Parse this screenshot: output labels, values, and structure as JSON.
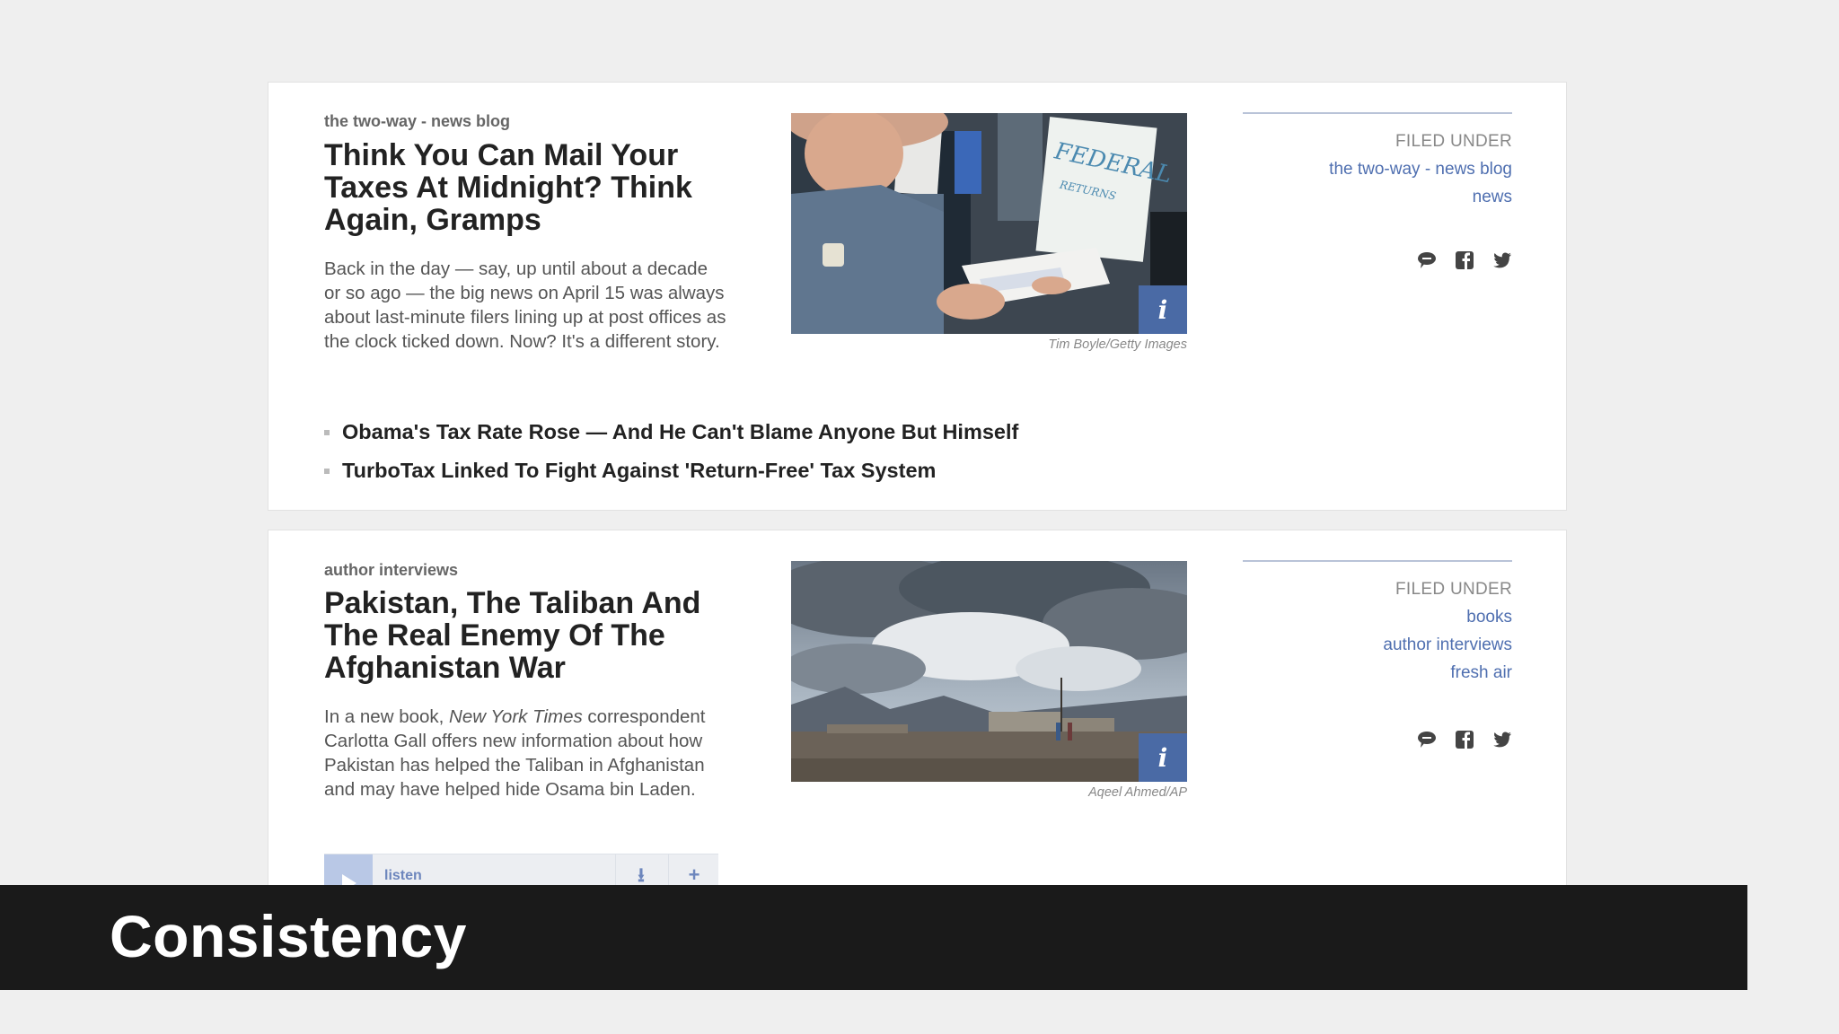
{
  "stories": [
    {
      "slug": "the two-way - news blog",
      "headline": "Think You Can Mail Your Taxes At Midnight? Think Again, Gramps",
      "teaser": "Back in the day — say, up until about a decade or so ago — the big news on April 15 was always about last-minute filers lining up at post offices as the clock ticked down. Now? It's a different story.",
      "image_credit": "Tim Boyle/Getty Images",
      "image_sign_text": "FEDERAL",
      "image_sign_subtext": "RETURNS",
      "related": [
        "Obama's Tax Rate Rose — And He Can't Blame Anyone But Himself",
        "TurboTax Linked To Fight Against 'Return-Free' Tax System"
      ],
      "filed_under_label": "FILED UNDER",
      "filed_under": [
        "the two-way - news blog",
        "news"
      ]
    },
    {
      "slug": "author interviews",
      "headline": "Pakistan, The Taliban And The Real Enemy Of The Afghanistan War",
      "teaser_parts": {
        "before": "In a new book, ",
        "italic": "New York Times",
        "after": " correspondent Carlotta Gall offers new information about how Pakistan has helped the Taliban in Afghanistan and may have helped hide Osama bin Laden."
      },
      "image_credit": "Aqeel Ahmed/AP",
      "filed_under_label": "FILED UNDER",
      "filed_under": [
        "books",
        "author interviews",
        "fresh air"
      ],
      "audio": {
        "listen_label": "listen",
        "download_glyph": "⭳",
        "add_glyph": "+"
      }
    }
  ],
  "info_glyph": "i",
  "banner": {
    "title": "Consistency"
  },
  "colors": {
    "background": "#efefef",
    "link": "#4f6fb0",
    "info_button": "#4a6aa5",
    "banner": "#1a1a1a"
  },
  "icons": [
    "comment-icon",
    "facebook-icon",
    "twitter-icon",
    "info-icon",
    "play-icon",
    "download-icon",
    "add-icon"
  ]
}
